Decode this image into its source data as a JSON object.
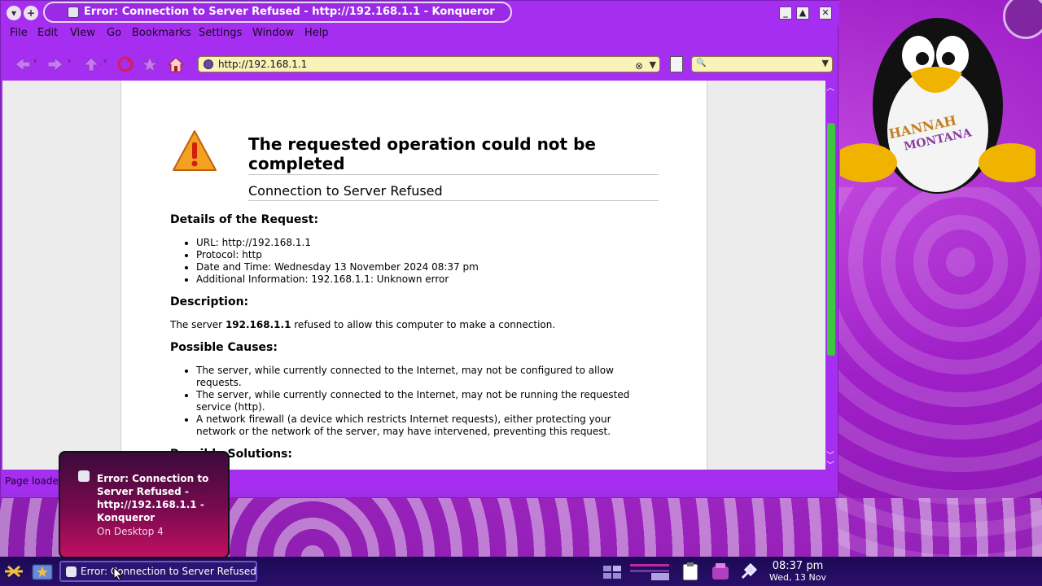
{
  "window": {
    "title": "Error: Connection to Server Refused - http://192.168.1.1 - Konqueror",
    "minimize": "_",
    "maximize": "▲",
    "close": "✕"
  },
  "menu": [
    "File",
    "Edit",
    "View",
    "Go",
    "Bookmarks",
    "Settings",
    "Window",
    "Help"
  ],
  "location": {
    "url": "http://192.168.1.1",
    "search_value": ""
  },
  "error_page": {
    "title": "The requested operation could not be completed",
    "subtitle": "Connection to Server Refused",
    "details_heading": "Details of the Request:",
    "details": [
      "URL: http://192.168.1.1",
      "Protocol: http",
      "Date and Time: Wednesday 13 November 2024 08:37 pm",
      "Additional Information: 192.168.1.1: Unknown error"
    ],
    "description_heading": "Description:",
    "description_prefix": "The server",
    "description_server": "192.168.1.1",
    "description_suffix": "refused to allow this computer to make a connection.",
    "causes_heading": "Possible Causes:",
    "causes": [
      "The server, while currently connected to the Internet, may not be configured to allow requests.",
      "The server, while currently connected to the Internet, may not be running the requested service (http).",
      "A network firewall (a device which restricts Internet requests), either protecting your network or the network of the server, may have intervened, preventing this request."
    ],
    "solutions_heading": "Possible Solutions:"
  },
  "status": {
    "text": "Page loaded."
  },
  "popup": {
    "title": "Error: Connection to Server Refused - http://192.168.1.1 - Konqueror",
    "subtitle": "On Desktop 4"
  },
  "taskbar": {
    "task_label": "Error: Connection to Server Refused",
    "time": "08:37 pm",
    "date": "Wed, 13 Nov"
  },
  "wallpaper": {
    "penguin_shirt_text": "HANNAH MONTANA"
  },
  "colors": {
    "window_accent": "#a52ef0",
    "url_field": "#fbf2b8",
    "scroll_thumb": "#3cc73c",
    "taskbar": "#1c0a54"
  }
}
